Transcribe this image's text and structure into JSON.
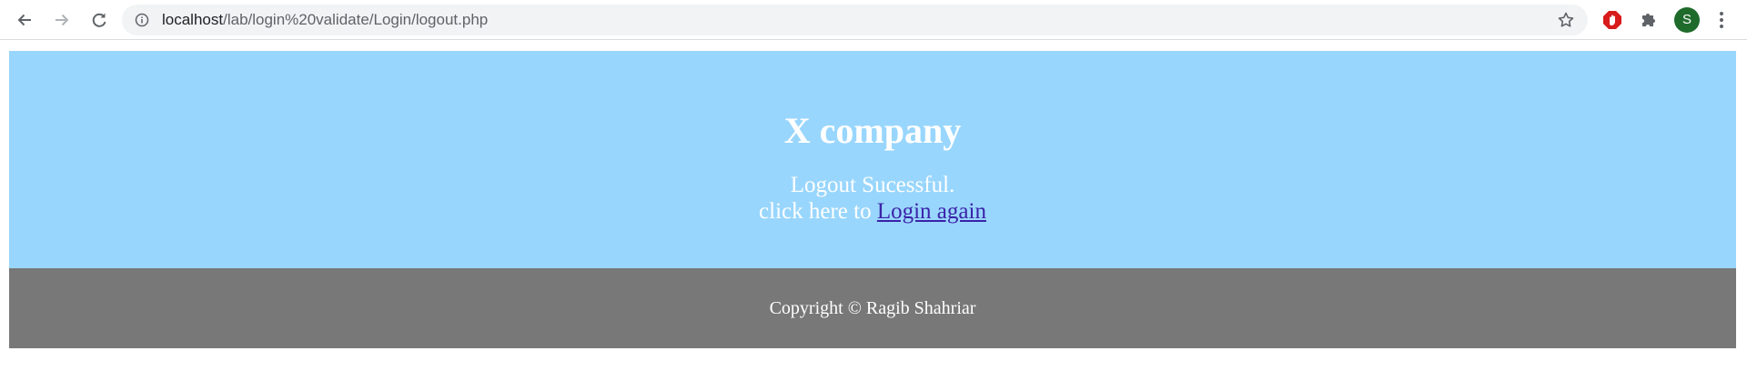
{
  "browser": {
    "url_host": "localhost",
    "url_path": "/lab/login%20validate/Login/logout.php",
    "profile_initial": "S"
  },
  "icons": {
    "back": "arrow-left-icon",
    "forward": "arrow-right-icon",
    "reload": "reload-icon",
    "info": "info-icon",
    "bookmark": "star-icon",
    "extension_red": "stop-hand-icon",
    "extensions": "puzzle-icon",
    "menu": "kebab-menu-icon"
  },
  "colors": {
    "hero_bg": "#99d6fd",
    "footer_bg": "#787878",
    "link": "#3b22a8",
    "avatar": "#1e6b2c",
    "extension_red": "#d81b1b"
  },
  "hero": {
    "title": "X company",
    "message": "Logout Sucessful.",
    "prompt": "click here to",
    "link_text": "Login again"
  },
  "footer": {
    "copyright": "Copyright © Ragib Shahriar"
  }
}
